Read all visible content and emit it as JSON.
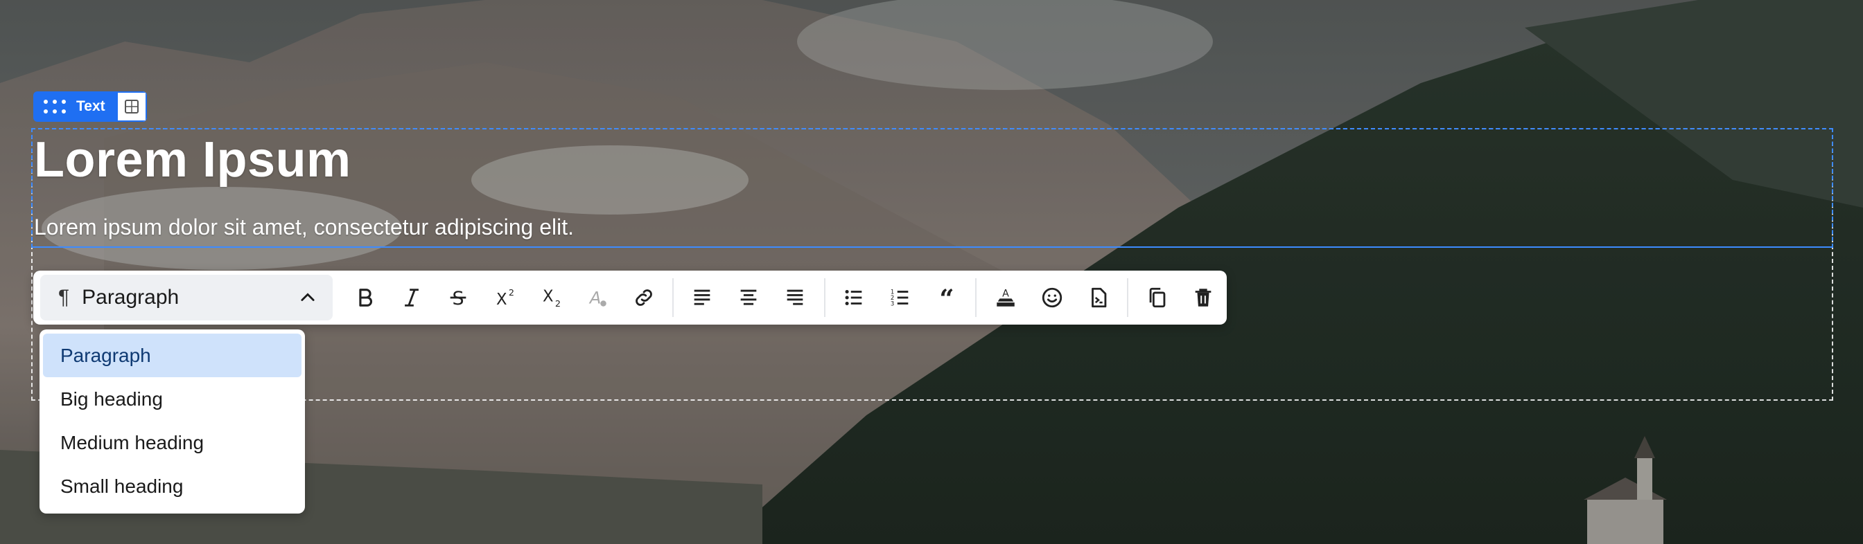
{
  "block_tag": {
    "label": "Text"
  },
  "content": {
    "heading": "Lorem Ipsum",
    "paragraph": "Lorem ipsum dolor sit amet, consectetur adipiscing elit."
  },
  "toolbar": {
    "format_select": {
      "value": "Paragraph",
      "icon": "pilcrow-icon"
    },
    "buttons": [
      "bold-icon",
      "italic-icon",
      "strikethrough-icon",
      "superscript-icon",
      "subscript-icon",
      "clear-format-icon",
      "link-icon",
      "align-left-icon",
      "align-center-icon",
      "align-right-icon",
      "bullet-list-icon",
      "numbered-list-icon",
      "quote-icon",
      "text-color-icon",
      "emoji-icon",
      "insert-field-icon",
      "duplicate-icon",
      "delete-icon"
    ]
  },
  "dropdown": {
    "options": [
      "Paragraph",
      "Big heading",
      "Medium heading",
      "Small heading"
    ],
    "selected": "Paragraph"
  },
  "colors": {
    "accent": "#1f6ff2",
    "selected_bg": "#cfe2fb"
  }
}
